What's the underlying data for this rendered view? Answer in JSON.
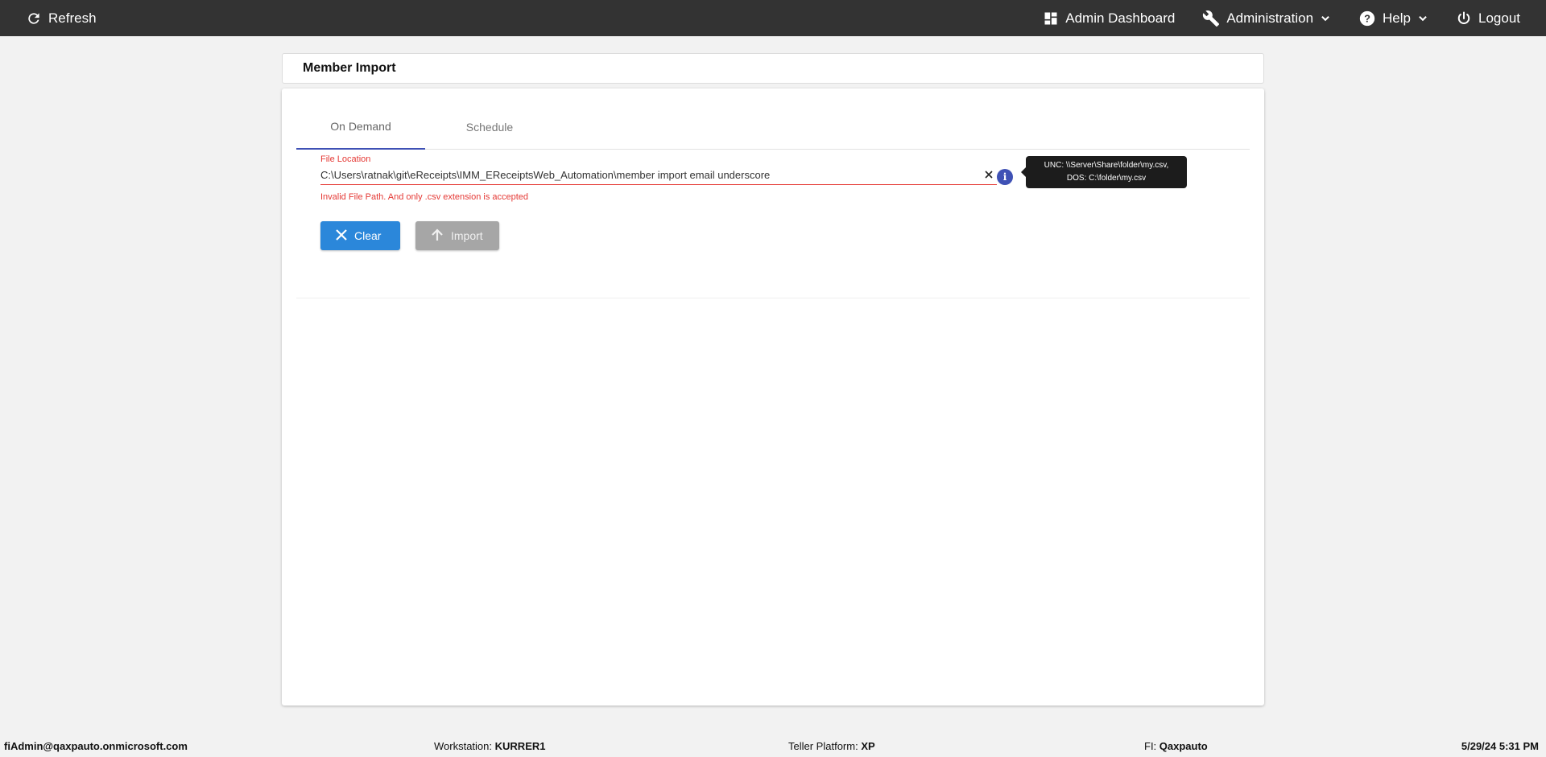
{
  "topbar": {
    "refresh_label": "Refresh",
    "admin_dashboard_label": "Admin Dashboard",
    "administration_label": "Administration",
    "help_label": "Help",
    "logout_label": "Logout"
  },
  "page": {
    "title": "Member Import"
  },
  "tabs": [
    {
      "label": "On Demand",
      "active": true
    },
    {
      "label": "Schedule",
      "active": false
    }
  ],
  "form": {
    "file_location_label": "File Location",
    "file_location_value": "C:\\Users\\ratnak\\git\\eReceipts\\IMM_EReceiptsWeb_Automation\\member import email underscore",
    "error_message": "Invalid File Path. And only .csv extension is accepted",
    "tooltip_line1": "UNC: \\\\Server\\Share\\folder\\my.csv,",
    "tooltip_line2": "DOS: C:\\folder\\my.csv",
    "clear_button_label": "Clear",
    "import_button_label": "Import"
  },
  "footer": {
    "user": "fiAdmin@qaxpauto.onmicrosoft.com",
    "workstation_label": "Workstation:",
    "workstation_value": "KURRER1",
    "teller_platform_label": "Teller Platform:",
    "teller_platform_value": "XP",
    "fi_label": "FI:",
    "fi_value": "Qaxpauto",
    "datetime": "5/29/24 5:31 PM"
  },
  "colors": {
    "topbar_bg": "#333333",
    "accent_blue": "#3f51b5",
    "error_red": "#e53935",
    "clear_button": "#2b87da",
    "import_button_disabled": "#a6a6a6"
  },
  "icons": {
    "refresh": "refresh-icon",
    "dashboard": "dashboard-icon",
    "administration": "wrench-icon",
    "help": "help-circle-icon",
    "logout": "power-icon",
    "clear_field": "close-icon",
    "info": "info-icon",
    "clear_button": "close-icon",
    "import_button": "arrow-up-icon"
  }
}
